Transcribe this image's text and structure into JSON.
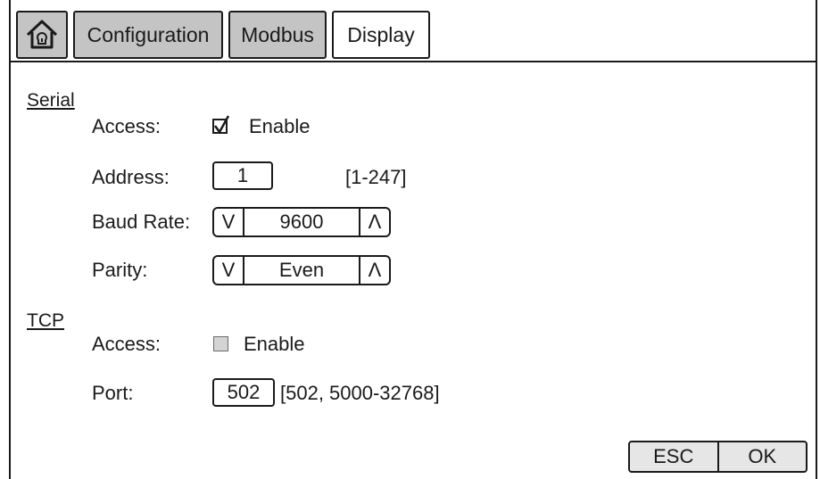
{
  "tabs": {
    "home_icon": "home-icon",
    "configuration": "Configuration",
    "modbus": "Modbus",
    "display": "Display"
  },
  "serial": {
    "heading": "Serial",
    "access_label": "Access:",
    "access_checked": true,
    "access_option": "Enable",
    "address_label": "Address:",
    "address_value": "1",
    "address_range": "[1-247]",
    "baud_label": "Baud Rate:",
    "baud_value": "9600",
    "parity_label": "Parity:",
    "parity_value": "Even"
  },
  "tcp": {
    "heading": "TCP",
    "access_label": "Access:",
    "access_checked": false,
    "access_option": "Enable",
    "port_label": "Port:",
    "port_value": "502",
    "port_range": "[502, 5000-32768]"
  },
  "spinner": {
    "down_glyph": "V",
    "up_glyph": "Λ"
  },
  "actions": {
    "esc": "ESC",
    "ok": "OK"
  },
  "colors": {
    "tab_inactive": "#c4c4c4",
    "tab_active": "#ffffff",
    "checkbox_off": "#d4d4d4"
  }
}
